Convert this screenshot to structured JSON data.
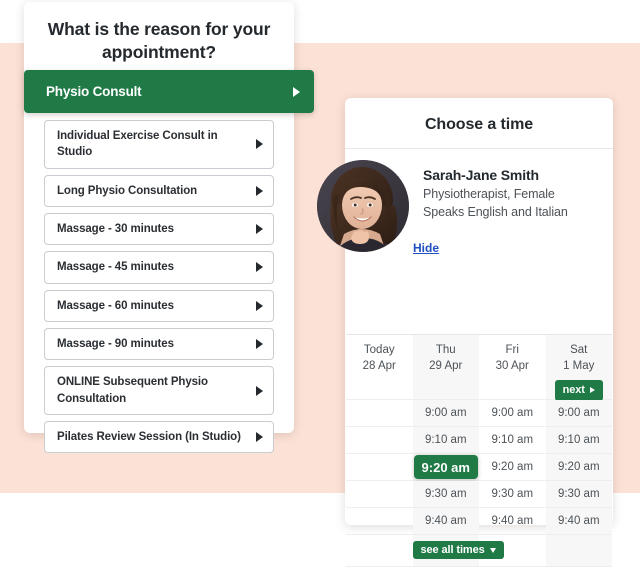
{
  "theme": {
    "background": "#fce2d6",
    "accent_green": "#1f7a45",
    "link_blue": "#1f4fbf",
    "text_dark": "#24292e"
  },
  "reason_panel": {
    "title": "What is the reason for your appointment?",
    "selected": {
      "label": "Physio Consult",
      "icon": "caret-right-icon"
    },
    "items": [
      {
        "label": "Individual Exercise Consult in Studio",
        "icon": "caret-right-icon"
      },
      {
        "label": "Long Physio Consultation",
        "icon": "caret-right-icon"
      },
      {
        "label": "Massage - 30 minutes",
        "icon": "caret-right-icon"
      },
      {
        "label": "Massage - 45 minutes",
        "icon": "caret-right-icon"
      },
      {
        "label": "Massage - 60 minutes",
        "icon": "caret-right-icon"
      },
      {
        "label": "Massage - 90 minutes",
        "icon": "caret-right-icon"
      },
      {
        "label": "ONLINE Subsequent Physio Consultation",
        "icon": "caret-right-icon"
      },
      {
        "label": "Pilates Review Session (In Studio)",
        "icon": "caret-right-icon"
      }
    ]
  },
  "time_panel": {
    "title": "Choose a time",
    "practitioner": {
      "name": "Sarah-Jane Smith",
      "role": "Physiotherapist, Female",
      "languages": "Speaks English and Italian",
      "avatar": "practitioner-photo"
    },
    "hide_label": "Hide",
    "next_button": {
      "label": "next",
      "icon": "caret-right-icon"
    },
    "see_all_button": {
      "label": "see all times",
      "icon": "caret-down-icon"
    },
    "columns": [
      {
        "day": "Today",
        "date": "28 Apr",
        "shaded": false
      },
      {
        "day": "Thu",
        "date": "29 Apr",
        "shaded": true
      },
      {
        "day": "Fri",
        "date": "30 Apr",
        "shaded": false
      },
      {
        "day": "Sat",
        "date": "1 May",
        "shaded": true
      }
    ],
    "rows": [
      {
        "slots": [
          "",
          "9:00 am",
          "9:00 am",
          "9:00 am"
        ],
        "selected_index": -1
      },
      {
        "slots": [
          "",
          "9:10 am",
          "9:10 am",
          "9:10 am"
        ],
        "selected_index": -1
      },
      {
        "slots": [
          "",
          "9:20 am",
          "9:20 am",
          "9:20 am"
        ],
        "selected_index": 1
      },
      {
        "slots": [
          "",
          "9:30 am",
          "9:30 am",
          "9:30 am"
        ],
        "selected_index": -1
      },
      {
        "slots": [
          "",
          "9:40 am",
          "9:40 am",
          "9:40 am"
        ],
        "selected_index": -1
      }
    ]
  }
}
